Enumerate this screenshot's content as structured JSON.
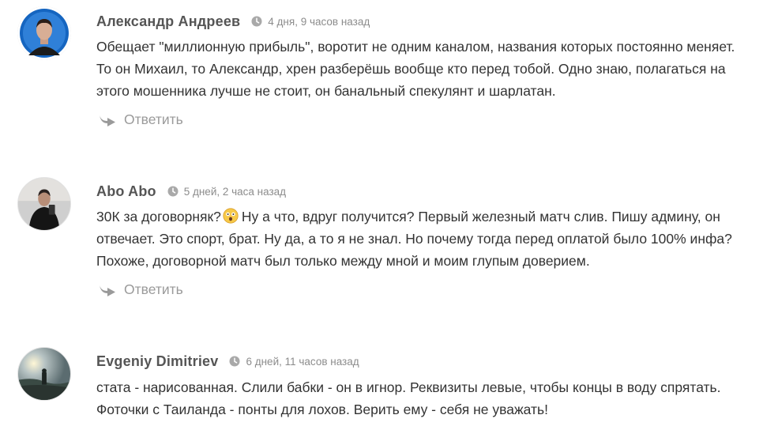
{
  "comments": [
    {
      "author": "Александр Андреев",
      "time": "4 дня, 9 часов назад",
      "lines": [
        "Обещает \"миллионную прибыль\", воротит не одним каналом, названия которых постоянно меняет.",
        "То он Михаил, то Александр, хрен разберёшь вообще кто перед тобой. Одно знаю, полагаться на",
        "этого мошенника лучше не стоит, он банальный спекулянт и шарлатан."
      ],
      "reply_label": "Ответить"
    },
    {
      "author": "Abo Abo",
      "time": "5 дней, 2 часа назад",
      "line1_before_emoji": "30К за договорняк?",
      "line1_after_emoji": "Ну а что, вдруг получится? Первый железный матч слив. Пишу админу, он",
      "lines": [
        "отвечает. Это спорт, брат. Ну да, а то я не знал. Но почему тогда перед оплатой было 100% инфа?",
        "Похоже, договорной матч был только между мной и моим глупым доверием."
      ],
      "emoji": "astonished-face",
      "reply_label": "Ответить"
    },
    {
      "author": "Evgeniy Dimitriev",
      "time": "6 дней, 11 часов назад",
      "lines": [
        "стата - нарисованная. Слили бабки - он в игнор. Реквизиты левые, чтобы концы в воду спрятать.",
        "Фоточки с Таиланда - понты для лохов. Верить ему - себя не уважать!"
      ]
    }
  ],
  "colors": {
    "author": "#555555",
    "time": "#8c8c8c",
    "text": "#333333",
    "reply": "#9a9a9a",
    "avatar_ring": "#1e88e5"
  }
}
